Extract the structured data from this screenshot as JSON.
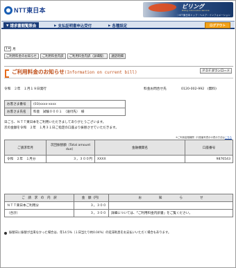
{
  "header": {
    "logo_text": "NTT東日本",
    "brand_name": "ビリング",
    "brand_sub": "Billing Information Service",
    "brand_links": "｜NTT東日本トップ｜ヘルプ・インフォメーション"
  },
  "nav": {
    "tabs": [
      {
        "label": "請求書閲覧照会"
      },
      {
        "label": "支払証明書申込受付"
      },
      {
        "label": "各種設定"
      }
    ],
    "logout_label": "ログアウト"
  },
  "controls": {
    "month_value": "1",
    "month_suffix": "月",
    "buttons": [
      {
        "label": "ご利用料金のお知らせ"
      },
      {
        "label": "ご利用料金内訳"
      },
      {
        "label": "ご利用料金内訳（詳細版）"
      },
      {
        "label": "通話明細"
      }
    ]
  },
  "title": {
    "main": "ご利用料金のお知らせ",
    "en": "(Information on current bill)",
    "pdf_label": "ＰＤＦダウンロード"
  },
  "meta": {
    "issued": "令和　２年　１月１９日発行",
    "inquiry_label": "料金お問合せ先",
    "inquiry_phone": "0120-002-992　(無料)"
  },
  "customer": {
    "number_label": "お客さま番号",
    "number_value": "(03)xxxx-xxxx",
    "name_label": "お客さま氏名",
    "name_value": "料金　試験０００１　（送付先）　様"
  },
  "message": {
    "line1": "日ごろ、ＮＴＴ東日本をご利用いただきましてありがとうございます。",
    "line2": "次の金額を令和　２年　１月３１日ご指定の口座より振替させていただきます。"
  },
  "note": {
    "text": "※ご利用金融機関（口座番号表示の表示方法は",
    "link": "こちら"
  },
  "billing_table": {
    "headers": [
      "ご請求年月",
      "次回振替額（Total amount due）",
      "金融機関名",
      "口座番号"
    ],
    "row": [
      "令和　２年　１月分",
      "３，３００円",
      "XXXX",
      "9876543"
    ]
  },
  "detail_table": {
    "headers": [
      "ご　請　求　の　内　訳",
      "金　額（円）",
      "お",
      "知",
      "ら",
      "せ"
    ],
    "rows": [
      {
        "item": "ＮＴＴ東日本ご利用分",
        "amount": "３，３００",
        "notice": ""
      },
      {
        "item": "（合計）",
        "amount": "３，３００",
        "notice": "詳細については、「ご利用料金内訳書」をご覧ください。"
      }
    ]
  },
  "footnote": "振替日に振替が出来なかった場合は、年14.5%（１日当たり約0.04%）の延滞利息をお支払いいただく場合もあります。"
}
